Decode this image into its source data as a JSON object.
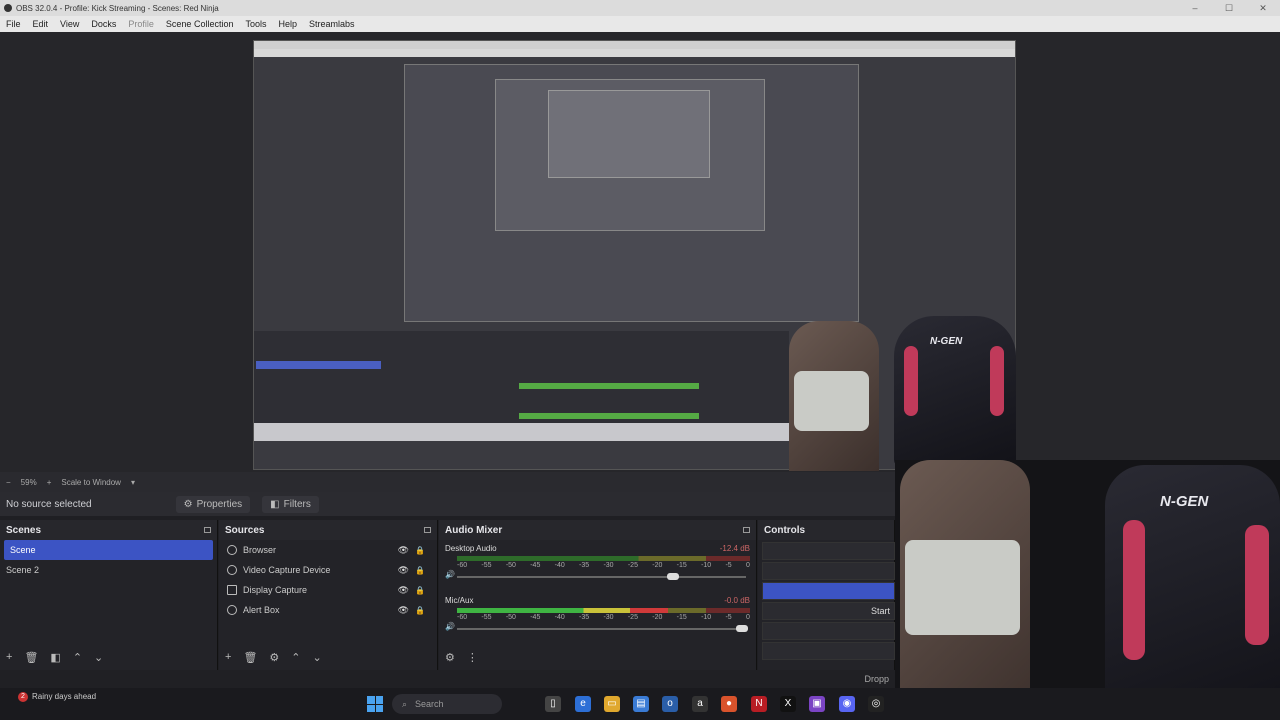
{
  "window": {
    "title": "OBS 32.0.4 - Profile: Kick Streaming - Scenes: Red Ninja"
  },
  "menu": [
    "File",
    "Edit",
    "View",
    "Docks",
    "Profile",
    "Scene Collection",
    "Tools",
    "Help",
    "Streamlabs"
  ],
  "zoom": {
    "level": "59%",
    "mode": "Scale to Window"
  },
  "source_toolbar": {
    "status": "No source selected",
    "properties": "Properties",
    "filters": "Filters"
  },
  "scenes": {
    "title": "Scenes",
    "items": [
      "Scene",
      "Scene 2"
    ]
  },
  "sources": {
    "title": "Sources",
    "items": [
      "Browser",
      "Video Capture Device",
      "Display Capture",
      "Alert Box"
    ]
  },
  "mixer": {
    "title": "Audio Mixer",
    "channels": [
      {
        "name": "Desktop Audio",
        "db": "-12.4 dB",
        "level": 0.0,
        "volume": 0.76
      },
      {
        "name": "Mic/Aux",
        "db": "-0.0 dB",
        "level": 0.72,
        "volume": 1.0
      }
    ],
    "ticks": [
      "-60",
      "-55",
      "-50",
      "-45",
      "-40",
      "-35",
      "-30",
      "-25",
      "-20",
      "-15",
      "-10",
      "-5",
      "0"
    ]
  },
  "controls": {
    "title": "Controls",
    "start_label": "Start"
  },
  "status": {
    "text": "Dropp"
  },
  "taskbar": {
    "weather": "Rainy days ahead",
    "badge": "2",
    "search": "Search"
  },
  "chair_brand": "N-GEN"
}
